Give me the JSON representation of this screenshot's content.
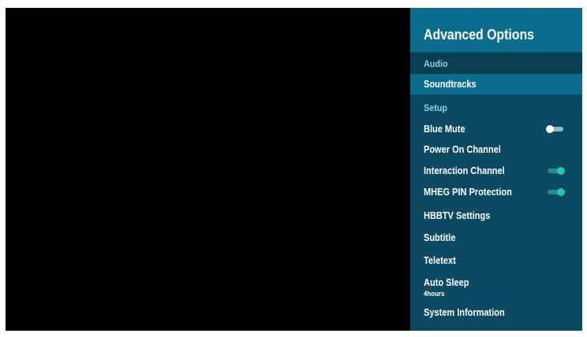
{
  "panel": {
    "title": "Advanced Options"
  },
  "sections": {
    "audio": {
      "label": "Audio",
      "items": [
        {
          "label": "Soundtracks",
          "selected": true
        }
      ]
    },
    "setup": {
      "label": "Setup",
      "items": [
        {
          "label": "Blue Mute",
          "toggle": "off"
        },
        {
          "label": "Power On Channel"
        },
        {
          "label": "Interaction Channel",
          "toggle": "on"
        },
        {
          "label": "MHEG PIN Protection",
          "toggle": "on"
        },
        {
          "label": "HBBTV Settings"
        },
        {
          "label": "Subtitle"
        },
        {
          "label": "Teletext"
        },
        {
          "label": "Auto Sleep",
          "value": "4hours"
        },
        {
          "label": "System Information"
        }
      ]
    }
  },
  "colors": {
    "panel_bg": "#0c4a63",
    "header_bg": "#0c6e8f",
    "selected_bg": "#0c6e8f",
    "section_label": "#8fd1e8",
    "toggle_on": "#26c6a6",
    "toggle_off": "#ffffff"
  }
}
